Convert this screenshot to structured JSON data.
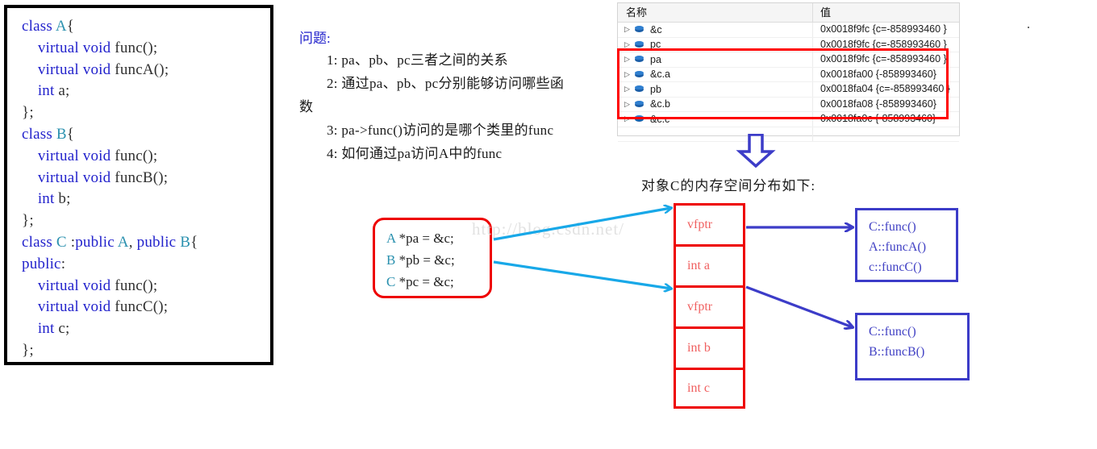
{
  "code_panel": {
    "lines": [
      [
        {
          "t": "class ",
          "c": "kw"
        },
        {
          "t": "A",
          "c": "typ"
        },
        {
          "t": "{",
          "c": "pun"
        }
      ],
      [
        {
          "t": "    ",
          "c": "pun"
        },
        {
          "t": "virtual void ",
          "c": "kw"
        },
        {
          "t": "func();",
          "c": "idn"
        }
      ],
      [
        {
          "t": "    ",
          "c": "pun"
        },
        {
          "t": "virtual void ",
          "c": "kw"
        },
        {
          "t": "funcA();",
          "c": "idn"
        }
      ],
      [
        {
          "t": "    ",
          "c": "pun"
        },
        {
          "t": "int ",
          "c": "kw"
        },
        {
          "t": "a;",
          "c": "idn"
        }
      ],
      [
        {
          "t": "};",
          "c": "pun"
        }
      ],
      [
        {
          "t": "class ",
          "c": "kw"
        },
        {
          "t": "B",
          "c": "typ"
        },
        {
          "t": "{",
          "c": "pun"
        }
      ],
      [
        {
          "t": "    ",
          "c": "pun"
        },
        {
          "t": "virtual void ",
          "c": "kw"
        },
        {
          "t": "func();",
          "c": "idn"
        }
      ],
      [
        {
          "t": "    ",
          "c": "pun"
        },
        {
          "t": "virtual void ",
          "c": "kw"
        },
        {
          "t": "funcB();",
          "c": "idn"
        }
      ],
      [
        {
          "t": "    ",
          "c": "pun"
        },
        {
          "t": "int ",
          "c": "kw"
        },
        {
          "t": "b;",
          "c": "idn"
        }
      ],
      [
        {
          "t": "};",
          "c": "pun"
        }
      ],
      [
        {
          "t": "class ",
          "c": "kw"
        },
        {
          "t": "C",
          "c": "typ"
        },
        {
          "t": " :",
          "c": "pun"
        },
        {
          "t": "public ",
          "c": "kw"
        },
        {
          "t": "A",
          "c": "typ"
        },
        {
          "t": ", ",
          "c": "pun"
        },
        {
          "t": "public ",
          "c": "kw"
        },
        {
          "t": "B",
          "c": "typ"
        },
        {
          "t": "{",
          "c": "pun"
        }
      ],
      [
        {
          "t": "public",
          "c": "kw"
        },
        {
          "t": ":",
          "c": "pun"
        }
      ],
      [
        {
          "t": "    ",
          "c": "pun"
        },
        {
          "t": "virtual void ",
          "c": "kw"
        },
        {
          "t": "func();",
          "c": "idn"
        }
      ],
      [
        {
          "t": "    ",
          "c": "pun"
        },
        {
          "t": "virtual void ",
          "c": "kw"
        },
        {
          "t": "funcC();",
          "c": "idn"
        }
      ],
      [
        {
          "t": "    ",
          "c": "pun"
        },
        {
          "t": "int ",
          "c": "kw"
        },
        {
          "t": "c;",
          "c": "idn"
        }
      ],
      [
        {
          "t": "};",
          "c": "pun"
        }
      ]
    ]
  },
  "questions": {
    "title": "问题:",
    "items": [
      "1: pa、pb、pc三者之间的关系",
      "2: 通过pa、pb、pc分别能够访问哪些函数",
      "3: pa->func()访问的是哪个类里的func",
      "4: 如何通过pa访问A中的func"
    ]
  },
  "watch_window": {
    "columns": {
      "name": "名称",
      "value": "值"
    },
    "rows": [
      {
        "name": "&c",
        "value": "0x0018f9fc {c=-858993460 }"
      },
      {
        "name": "pc",
        "value": "0x0018f9fc {c=-858993460 }"
      },
      {
        "name": "pa",
        "value": "0x0018f9fc {c=-858993460 }"
      },
      {
        "name": "&c.a",
        "value": "0x0018fa00 {-858993460}"
      },
      {
        "name": "pb",
        "value": "0x0018fa04 {c=-858993460 }"
      },
      {
        "name": "&c.b",
        "value": "0x0018fa08 {-858993460}"
      },
      {
        "name": "&c.c",
        "value": "0x0018fa0c {-858993460}"
      }
    ]
  },
  "memory_caption": "对象C的内存空间分布如下:",
  "pointer_box": {
    "lines": [
      [
        {
          "t": "A",
          "c": "ptr-cls"
        },
        {
          "t": " *pa = &c;",
          "c": ""
        }
      ],
      [
        {
          "t": "B",
          "c": "ptr-cls"
        },
        {
          "t": " *pb = &c;",
          "c": ""
        }
      ],
      [
        {
          "t": "C",
          "c": "ptr-cls"
        },
        {
          "t": " *pc = &c;",
          "c": ""
        }
      ]
    ]
  },
  "watermark": "http://blog.csdn.net/",
  "memory_layout": {
    "cells": [
      "vfptr",
      "int a",
      "vfptr",
      "int b",
      "int c"
    ]
  },
  "vtable_a": {
    "entries": [
      "C::func()",
      "A::funcA()",
      "c::funcC()"
    ]
  },
  "vtable_b": {
    "entries": [
      "C::func()",
      "B::funcB()"
    ]
  },
  "colors": {
    "red_border": "#ee0000",
    "blue_arrow": "#3c3cc8",
    "cyan_arrow": "#18a8e8",
    "keyword_blue": "#2222cc",
    "type_teal": "#2b91af",
    "mem_label_red": "#f06060",
    "watch_highlight": "#ff0000"
  }
}
